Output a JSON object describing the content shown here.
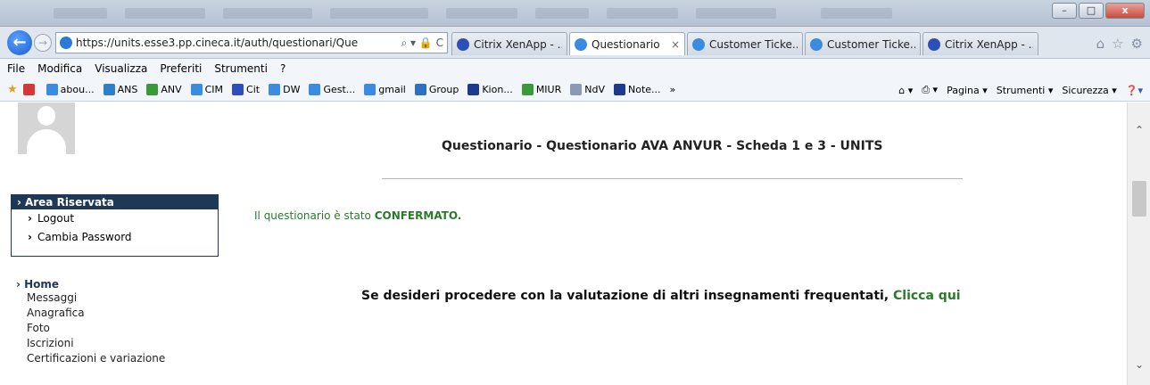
{
  "window": {
    "minimize": "–",
    "maximize": "□",
    "close": "x"
  },
  "nav": {
    "back": "←",
    "forward": "→",
    "url": "https://units.esse3.pp.cineca.it/auth/questionari/Que",
    "url_tools": "⌕ ▾ 🔒 C"
  },
  "tabs": [
    {
      "label": "Citrix XenApp - ...",
      "icon": "citrix-icon",
      "close": ""
    },
    {
      "label": "Questionario",
      "icon": "ie-icon",
      "close": "×"
    },
    {
      "label": "Customer Ticke...",
      "icon": "ie-icon",
      "close": ""
    },
    {
      "label": "Customer Ticke...",
      "icon": "ie-icon",
      "close": ""
    },
    {
      "label": "Citrix XenApp - ...",
      "icon": "citrix-icon",
      "close": ""
    }
  ],
  "menu": [
    "File",
    "Modifica",
    "Visualizza",
    "Preferiti",
    "Strumenti",
    "?"
  ],
  "favorites": [
    {
      "label": "",
      "color": "#d23a3a"
    },
    {
      "label": "abou...",
      "color": "#3b8bde"
    },
    {
      "label": "ANS",
      "color": "#2d7fc6"
    },
    {
      "label": "ANV",
      "color": "#3a9a3a"
    },
    {
      "label": "CIM",
      "color": "#3b8bde"
    },
    {
      "label": "Cit",
      "color": "#2f4fb8"
    },
    {
      "label": "DW",
      "color": "#3b8bde"
    },
    {
      "label": "Gest...",
      "color": "#3b8bde"
    },
    {
      "label": "gmail",
      "color": "#3b8bde"
    },
    {
      "label": "Group",
      "color": "#2f6fc0"
    },
    {
      "label": "Kion...",
      "color": "#1e3a8a"
    },
    {
      "label": "MIUR",
      "color": "#3a9a3a"
    },
    {
      "label": "NdV",
      "color": "#8a9ab0"
    },
    {
      "label": "Note...",
      "color": "#1e3a8a"
    }
  ],
  "fav_right": {
    "pagina": "Pagina ▾",
    "strumenti": "Strumenti ▾",
    "sicurezza": "Sicurezza ▾"
  },
  "page": {
    "title": "Questionario - Questionario AVA ANVUR - Scheda 1 e 3 - UNITS",
    "area_title": "Area Riservata",
    "area_items": [
      "Logout",
      "Cambia Password"
    ],
    "confirm_prefix": "Il questionario è stato ",
    "confirm_status": "CONFERMATO.",
    "home": "Home",
    "menu_items": [
      "Messaggi",
      "Anagrafica",
      "Foto",
      "Iscrizioni",
      "Certificazioni e variazione"
    ],
    "message": "Se desideri procedere con la valutazione di altri insegnamenti frequentati, ",
    "link": "Clicca qui"
  }
}
